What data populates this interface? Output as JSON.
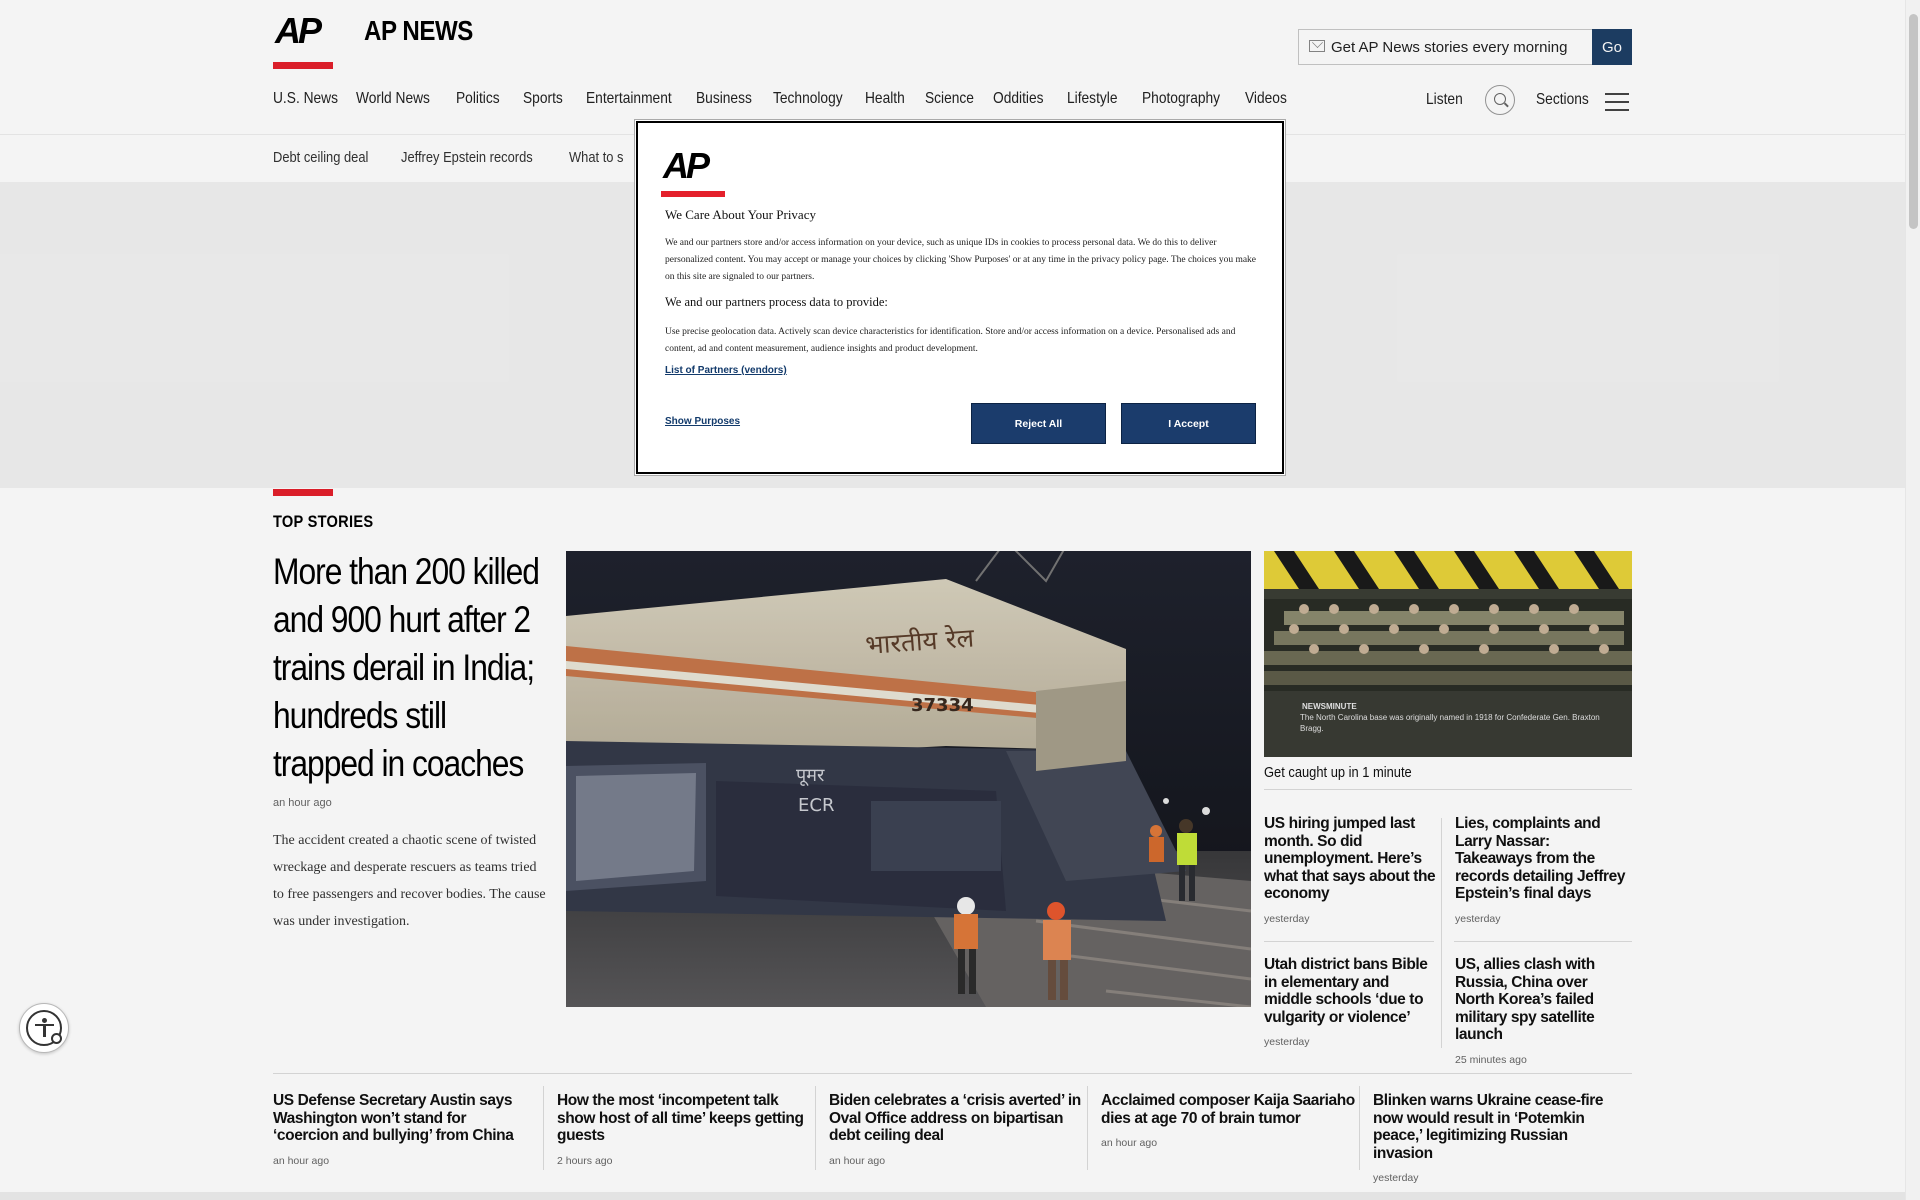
{
  "header": {
    "logo_text": "AP",
    "brand": "AP NEWS",
    "newsletter_placeholder": "Get AP News stories every morning",
    "go_label": "Go",
    "nav": [
      "U.S. News",
      "World News",
      "Politics",
      "Sports",
      "Entertainment",
      "Business",
      "Technology",
      "Health",
      "Science",
      "Oddities",
      "Lifestyle",
      "Photography",
      "Videos"
    ],
    "listen": "Listen",
    "sections": "Sections"
  },
  "trending": [
    "Debt ceiling deal",
    "Jeffrey Epstein records",
    "What to s"
  ],
  "top_stories": {
    "label": "TOP STORIES",
    "lead": {
      "headline": "More than 200 killed and 900 hurt after 2 trains derail in India; hundreds still trapped in coaches",
      "time": "an hour ago",
      "summary": "The accident created a chaotic scene of twisted wreckage and desperate rescuers as teams tried to free passengers and recover bodies. The cause was under investigation."
    },
    "lead_image": {
      "train_text": "भारतीय रेल",
      "train_number": "37334",
      "side_text_1": "पूमर",
      "side_text_2": "ECR"
    },
    "newsminute": {
      "label": "NEWSMINUTE",
      "text": "The North Carolina base was originally named in 1918 for Confederate Gen. Braxton Bragg.",
      "caption": "Get caught up in 1 minute"
    },
    "side_stories": [
      {
        "headline": "US hiring jumped last month. So did unemployment. Here’s what that says about the economy",
        "time": "yesterday"
      },
      {
        "headline": "Lies, complaints and Larry Nassar: Takeaways from the records detailing Jeffrey Epstein’s final days",
        "time": "yesterday"
      },
      {
        "headline": "Utah district bans Bible in elementary and middle schools ‘due to vulgarity or violence’",
        "time": "yesterday"
      },
      {
        "headline": "US, allies clash with Russia, China over North Korea’s failed military spy satellite launch",
        "time": "25 minutes ago"
      }
    ],
    "bottom_stories": [
      {
        "headline": "US Defense Secretary Austin says Washington won’t stand for ‘coercion and bullying’ from China",
        "time": "an hour ago"
      },
      {
        "headline": "How the most ‘incompetent talk show host of all time’ keeps getting guests",
        "time": "2 hours ago"
      },
      {
        "headline": "Biden celebrates a ‘crisis averted’ in Oval Office address on bipartisan debt ceiling deal",
        "time": "an hour ago"
      },
      {
        "headline": "Acclaimed composer Kaija Saariaho dies at age 70 of brain tumor",
        "time": "an hour ago"
      },
      {
        "headline": "Blinken warns Ukraine cease-fire now would result in ‘Potemkin peace,’ legitimizing Russian invasion",
        "time": "yesterday"
      }
    ]
  },
  "privacy_modal": {
    "logo_text": "AP",
    "title": "We Care About Your Privacy",
    "text1": "We and our partners store and/or access information on your device, such as unique IDs in cookies to process personal data. We do this to deliver personalized content. You may accept or manage your choices by clicking 'Show Purposes' or at any time in the privacy policy page. The choices you make on this site are signaled to our partners.",
    "subtitle": "We and our partners process data to provide:",
    "text2": "Use precise geolocation data. Actively scan device characteristics for identification. Store and/or access information on a device. Personalised ads and content, ad and content measurement, audience insights and product development.",
    "partners_link": "List of Partners (vendors)",
    "show_purposes": "Show Purposes",
    "reject_label": "Reject All",
    "accept_label": "I Accept"
  },
  "colors": {
    "ap_red": "#e4202b",
    "button_navy": "#1b3c6c",
    "go_navy": "#1e3f66"
  }
}
